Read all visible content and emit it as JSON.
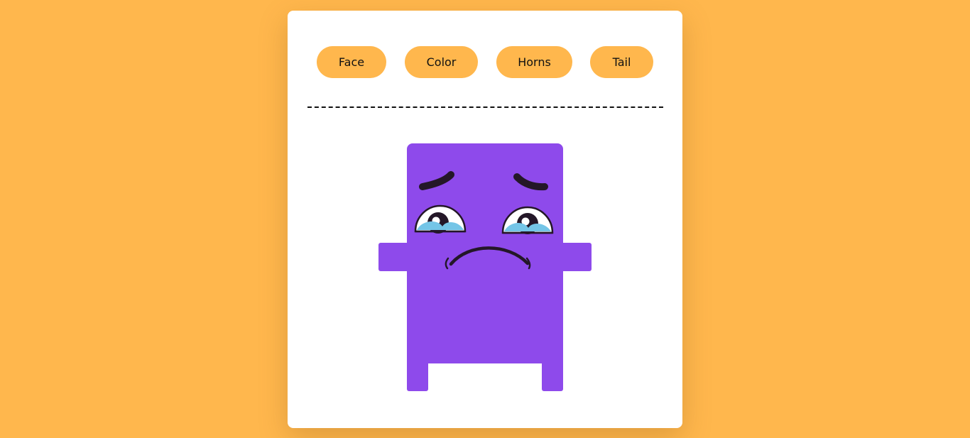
{
  "toolbar": {
    "buttons": [
      {
        "label": "Face"
      },
      {
        "label": "Color"
      },
      {
        "label": "Horns"
      },
      {
        "label": "Tail"
      }
    ]
  },
  "colors": {
    "background": "#FFB74D",
    "button": "#FFB74D",
    "card": "#FFFFFF",
    "monster_body": "#8E4AEB",
    "tear": "#74C5E7"
  },
  "monster": {
    "expression": "sad-crying-face-icon"
  }
}
